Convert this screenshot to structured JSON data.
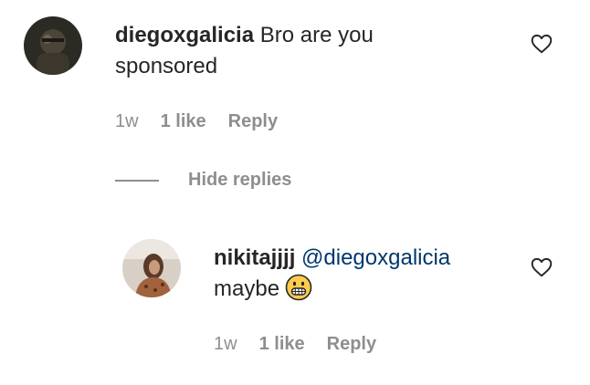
{
  "comment": {
    "username": "diegoxgalicia",
    "text": "Bro are you sponsored",
    "time": "1w",
    "likes": "1 like",
    "reply_label": "Reply"
  },
  "replies_toggle": {
    "label": "Hide replies"
  },
  "reply": {
    "username": "nikitajjjj",
    "mention": "@diegoxgalicia",
    "text": "maybe",
    "emoji": "grimacing-face-emoji",
    "time": "1w",
    "likes": "1 like",
    "reply_label": "Reply"
  },
  "colors": {
    "text": "#262626",
    "secondary": "#8e8e8e",
    "mention": "#00376b",
    "emoji_yellow": "#ffcc4d"
  },
  "icons": {
    "like": "heart-outline-icon"
  }
}
